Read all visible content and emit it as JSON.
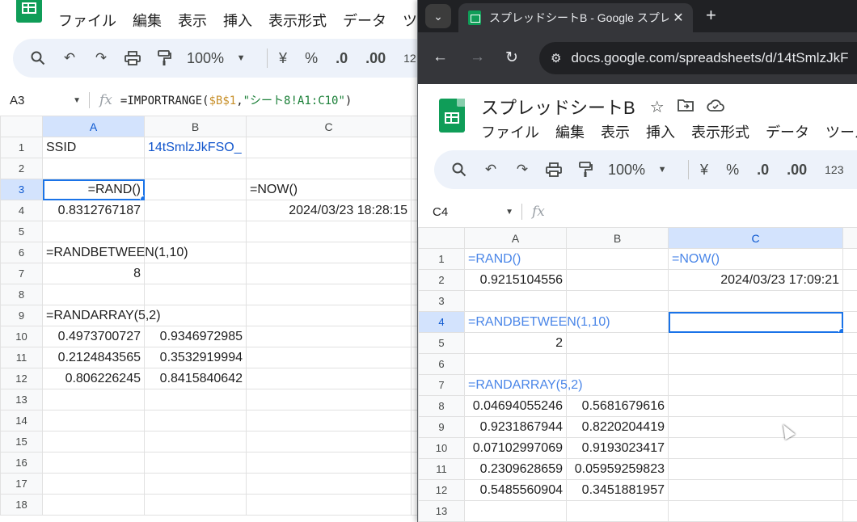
{
  "left_window": {
    "menu": [
      "ファイル",
      "編集",
      "表示",
      "挿入",
      "表示形式",
      "データ",
      "ツー"
    ],
    "toolbar": {
      "zoom": "100%",
      "currency": "¥",
      "percent": "%",
      "dec_decrease": ".0",
      "dec_increase": ".00",
      "more": "12"
    },
    "namebox": "A3",
    "formula": {
      "prefix": "=IMPORTRANGE(",
      "ref": "$B$1",
      "sep": ",",
      "str": "\"シート8!A1:C10\"",
      "suffix": ")"
    },
    "columns": [
      "A",
      "B",
      "C"
    ],
    "rows": [
      "1",
      "2",
      "3",
      "4",
      "5",
      "6",
      "7",
      "8",
      "9",
      "10",
      "11",
      "12",
      "13",
      "14",
      "15",
      "16",
      "17",
      "18"
    ],
    "cells": {
      "A1": "SSID",
      "B1": "14tSmlzJkFSO_",
      "A3": "=RAND()",
      "C3": "=NOW()",
      "A4": "0.8312767187",
      "C4": "2024/03/23 18:28:15",
      "A6": "=RANDBETWEEN(1,10)",
      "A7": "8",
      "A9": "=RANDARRAY(5,2)",
      "A10": "0.4973700727",
      "B10": "0.9346972985",
      "A11": "0.2124843565",
      "B11": "0.3532919994",
      "A12": "0.806226245",
      "B12": "0.8415840642"
    }
  },
  "right_window": {
    "tab_title": "スプレッドシートB - Google スプレッ",
    "url_site": "docs.google.com",
    "url_path": "/spreadsheets/d/14tSmlzJkF",
    "doc_title": "スプレッドシートB",
    "menu": [
      "ファイル",
      "編集",
      "表示",
      "挿入",
      "表示形式",
      "データ",
      "ツール"
    ],
    "toolbar": {
      "zoom": "100%",
      "currency": "¥",
      "percent": "%",
      "dec_decrease": ".0",
      "dec_increase": ".00",
      "more": "123"
    },
    "namebox": "C4",
    "columns": [
      "A",
      "B",
      "C"
    ],
    "rows": [
      "1",
      "2",
      "3",
      "4",
      "5",
      "6",
      "7",
      "8",
      "9",
      "10",
      "11",
      "12",
      "13"
    ],
    "cells": {
      "A1": "=RAND()",
      "C1": "=NOW()",
      "A2": "0.9215104556",
      "C2": "2024/03/23 17:09:21",
      "A4": "=RANDBETWEEN(1,10)",
      "A5": "2",
      "A7": "=RANDARRAY(5,2)",
      "A8": "0.04694055246",
      "B8": "0.5681679616",
      "A9": "0.9231867944",
      "B9": "0.8220204419",
      "A10": "0.07102997069",
      "B10": "0.9193023417",
      "A11": "0.2309628659",
      "B11": "0.05959259823",
      "A12": "0.5485560904",
      "B12": "0.3451881957"
    }
  },
  "colors": {
    "accent": "#1a73e8",
    "header_selected": "#d3e3fd",
    "formula_text": "#4a86e8",
    "sheets_green": "#0f9d58"
  }
}
